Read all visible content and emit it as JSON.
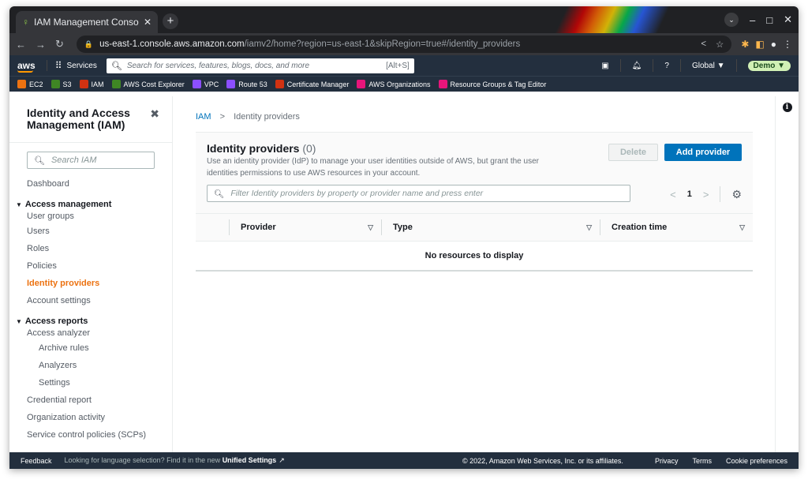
{
  "browser": {
    "tab_title": "IAM Management Consol",
    "url_host": "us-east-1.console.aws.amazon.com",
    "url_path": "/iamv2/home?region=us-east-1&skipRegion=true#/identity_providers"
  },
  "aws_nav": {
    "logo": "aws",
    "services_label": "Services",
    "search_placeholder": "Search for services, features, blogs, docs, and more",
    "search_shortcut": "[Alt+S]",
    "region": "Global ▼",
    "account": "Demo ▼"
  },
  "favorites": [
    {
      "label": "EC2",
      "color": "#ec7211"
    },
    {
      "label": "S3",
      "color": "#3f8624"
    },
    {
      "label": "IAM",
      "color": "#d13212"
    },
    {
      "label": "AWS Cost Explorer",
      "color": "#3f8624"
    },
    {
      "label": "VPC",
      "color": "#8c4fff"
    },
    {
      "label": "Route 53",
      "color": "#8c4fff"
    },
    {
      "label": "Certificate Manager",
      "color": "#d13212"
    },
    {
      "label": "AWS Organizations",
      "color": "#e7157b"
    },
    {
      "label": "Resource Groups & Tag Editor",
      "color": "#e7157b"
    }
  ],
  "sidebar": {
    "title": "Identity and Access Management (IAM)",
    "search_placeholder": "Search IAM",
    "dashboard": "Dashboard",
    "section_access_management": "Access management",
    "user_groups": "User groups",
    "users": "Users",
    "roles": "Roles",
    "policies": "Policies",
    "identity_providers": "Identity providers",
    "account_settings": "Account settings",
    "section_access_reports": "Access reports",
    "access_analyzer": "Access analyzer",
    "archive_rules": "Archive rules",
    "analyzers": "Analyzers",
    "settings": "Settings",
    "credential_report": "Credential report",
    "organization_activity": "Organization activity",
    "scps": "Service control policies (SCPs)"
  },
  "main": {
    "breadcrumb_root": "IAM",
    "breadcrumb_current": "Identity providers",
    "title": "Identity providers",
    "count": "(0)",
    "description": "Use an identity provider (IdP) to manage your user identities outside of AWS, but grant the user identities permissions to use AWS resources in your account.",
    "delete_label": "Delete",
    "add_label": "Add provider",
    "filter_placeholder": "Filter Identity providers by property or provider name and press enter",
    "page_number": "1",
    "columns": [
      "Provider",
      "Type",
      "Creation time"
    ],
    "empty_message": "No resources to display"
  },
  "footer": {
    "feedback": "Feedback",
    "hint": "Looking for language selection? Find it in the new",
    "hint_link": "Unified Settings",
    "copyright": "© 2022, Amazon Web Services, Inc. or its affiliates.",
    "privacy": "Privacy",
    "terms": "Terms",
    "cookies": "Cookie preferences"
  }
}
